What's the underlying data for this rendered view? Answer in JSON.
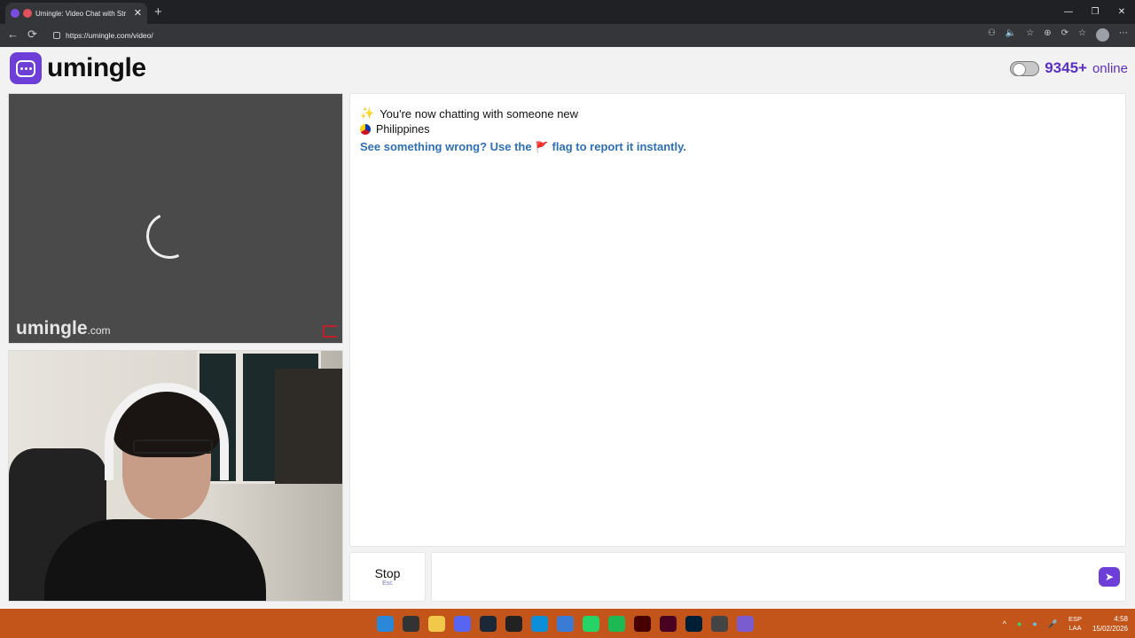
{
  "browser": {
    "tab_title": "Umingle: Video Chat with Str",
    "tab_close": "✕",
    "new_tab": "+",
    "url": "https://umingle.com/video/",
    "back": "←",
    "reload": "⟳",
    "window_controls": [
      "—",
      "❐",
      "✕"
    ],
    "extension_icons": [
      "⚇",
      "🔈",
      "☆",
      "⊕",
      "⟳",
      "☆",
      "⋯"
    ]
  },
  "header": {
    "logo_text": "umingle",
    "online_count": "9345+",
    "online_label": "online"
  },
  "stranger_video": {
    "watermark_brand": "umingle",
    "watermark_domain": ".com"
  },
  "chat": {
    "sparkle_icon": "✨",
    "status_message": "You're now chatting with someone new",
    "country": "Philippines",
    "report_text_before": "See something wrong? Use the",
    "report_flag_icon": "🚩",
    "report_text_after": "flag to report it instantly."
  },
  "controls": {
    "stop_label": "Stop",
    "stop_shortcut": "Esc",
    "input_placeholder": "",
    "send_icon": "➤"
  },
  "taskbar": {
    "tray_icons": [
      "^",
      "●",
      "●",
      "🎤"
    ],
    "language_line1": "ESP",
    "language_line2": "LAA",
    "time": "4:58",
    "date": "15/02/2026",
    "app_colors": [
      "#2b88d8",
      "#333333",
      "#f2c84b",
      "#5865f2",
      "#1b2838",
      "#222222",
      "#0c8fd8",
      "#3a7bd5",
      "#25d366",
      "#1db954",
      "#470000",
      "#49021f",
      "#001e36",
      "#444444",
      "#7a5cd0"
    ]
  },
  "colors": {
    "brand_purple": "#6e3fd8",
    "online_text": "#5a2fc4",
    "report_link": "#2f6fb7",
    "taskbar": "#c4551a"
  }
}
